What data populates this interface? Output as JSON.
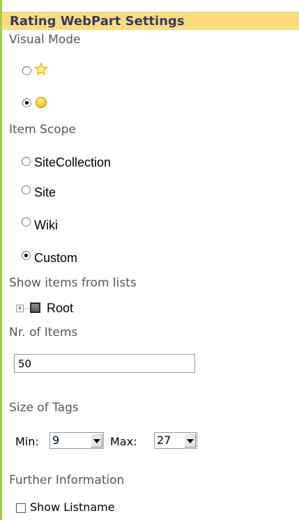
{
  "header": {
    "title": "Rating WebPart Settings"
  },
  "visual_mode": {
    "label": "Visual Mode",
    "options": [
      {
        "icon": "star-icon",
        "checked": false
      },
      {
        "icon": "smiley-icon",
        "checked": true
      }
    ]
  },
  "item_scope": {
    "label": "Item Scope",
    "options": [
      {
        "label": "SiteCollection",
        "checked": false
      },
      {
        "label": "Site",
        "checked": false
      },
      {
        "label": "Wiki",
        "checked": false
      },
      {
        "label": "Custom",
        "checked": true
      }
    ]
  },
  "lists": {
    "label": "Show items from lists",
    "tree": {
      "expander": "+",
      "root_label": "Root"
    }
  },
  "nr_items": {
    "label": "Nr. of Items",
    "value": "50"
  },
  "tag_size": {
    "label": "Size of Tags",
    "min_label": "Min:",
    "min_value": "9",
    "max_label": "Max:",
    "max_value": "27"
  },
  "further": {
    "label": "Further Information",
    "show_listname_label": "Show Listname",
    "show_listname_checked": false
  },
  "colors": {
    "header_bg": "#fddc80",
    "header_text": "#333c66",
    "left_border": "#9fcf3f",
    "section_label": "#555555",
    "star": "#f5c400"
  }
}
